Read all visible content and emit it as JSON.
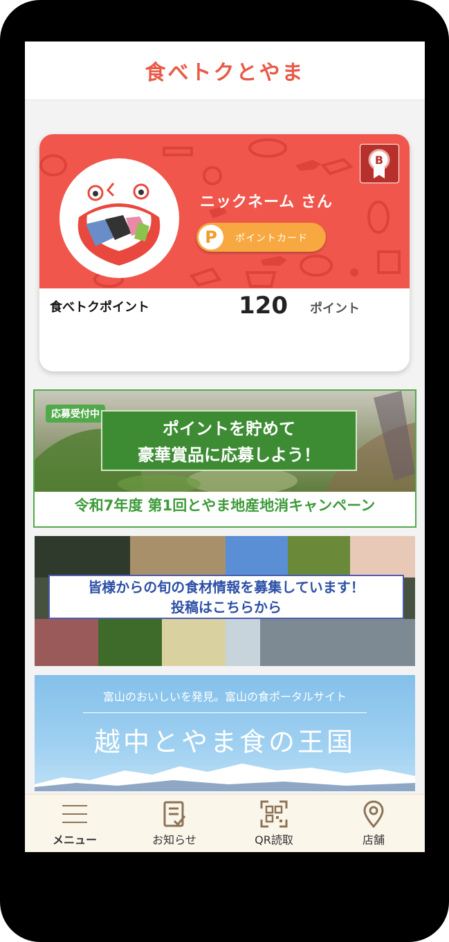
{
  "header": {
    "title": "食べトクとやま"
  },
  "card": {
    "nickname": "ニックネーム さん",
    "point_card_icon": "P",
    "point_card_label": "ポイントカード",
    "badge_letter": "B",
    "points_label": "食べトクポイント",
    "points_value": "120",
    "points_unit": "ポイント"
  },
  "campaign_banner": {
    "tag": "応募受付中",
    "headline_line1": "ポイントを貯めて",
    "headline_line2": "豪華賞品に応募しよう！",
    "caption": "令和7年度 第1回とやま地産地消キャンペーン"
  },
  "ingredients_banner": {
    "line1": "皆様からの旬の食材情報を募集しています！",
    "line2": "投稿はこちらから"
  },
  "portal_banner": {
    "subtitle": "富山のおいしいを発見。富山の食ポータルサイト",
    "title": "越中とやま食の王国"
  },
  "tabbar": {
    "items": [
      {
        "label": "メニュー",
        "icon": "hamburger-menu-icon"
      },
      {
        "label": "お知らせ",
        "icon": "notice-icon"
      },
      {
        "label": "QR読取",
        "icon": "qr-code-icon"
      },
      {
        "label": "店舗",
        "icon": "location-pin-icon"
      }
    ]
  },
  "colors": {
    "brand_red": "#f0564c",
    "title_red": "#e95a47",
    "orange": "#f7a840",
    "green": "#52a94b",
    "badge_red": "#b8302b",
    "tab_icon": "#8a7357"
  }
}
